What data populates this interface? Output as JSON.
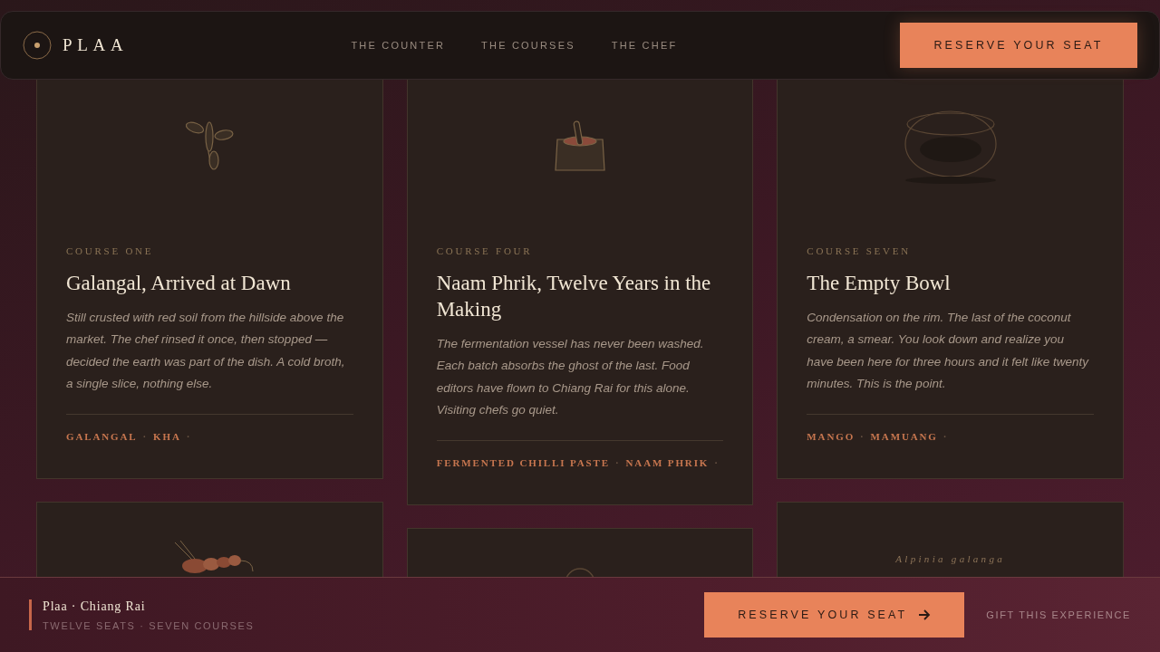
{
  "header": {
    "brand": "PLAA",
    "nav": [
      "THE COUNTER",
      "THE COURSES",
      "THE CHEF"
    ],
    "cta": "RESERVE YOUR SEAT"
  },
  "separator": "·",
  "columns": [
    {
      "cards": [
        {
          "kind": "sprig",
          "label": "COURSE ONE",
          "title": "Galangal, Arrived at Dawn",
          "description": "Still crusted with red soil from the hillside above the market. The chef rinsed it once, then stopped — decided the earth was part of the dish. A cold broth, a single slice, nothing else.",
          "tags": [
            "GALANGAL",
            "KHA"
          ]
        },
        {
          "kind": "shrimp"
        }
      ]
    },
    {
      "cards": [
        {
          "kind": "mortar",
          "label": "COURSE FOUR",
          "title": "Naam Phrik, Twelve Years in the Making",
          "description": "The fermentation vessel has never been washed. Each batch absorbs the ghost of the last. Food editors have flown to Chiang Rai for this alone. Visiting chefs go quiet.",
          "tags": [
            "FERMENTED CHILLI PASTE",
            "NAAM PHRIK"
          ]
        },
        {
          "kind": "orb"
        }
      ]
    },
    {
      "cards": [
        {
          "kind": "bowl",
          "label": "COURSE SEVEN",
          "title": "The Empty Bowl",
          "description": "Condensation on the rim. The last of the coconut cream, a smear. You look down and realize you have been here for three hours and it felt like twenty minutes. This is the point.",
          "tags": [
            "MANGO",
            "MAMUANG"
          ]
        },
        {
          "kind": "caption",
          "caption": "Alpinia galanga"
        }
      ]
    }
  ],
  "footer": {
    "title": "Plaa · Chiang Rai",
    "subtitle": "TWELVE SEATS · SEVEN COURSES",
    "cta": "RESERVE YOUR SEAT",
    "link": "GIFT THIS EXPERIENCE"
  }
}
